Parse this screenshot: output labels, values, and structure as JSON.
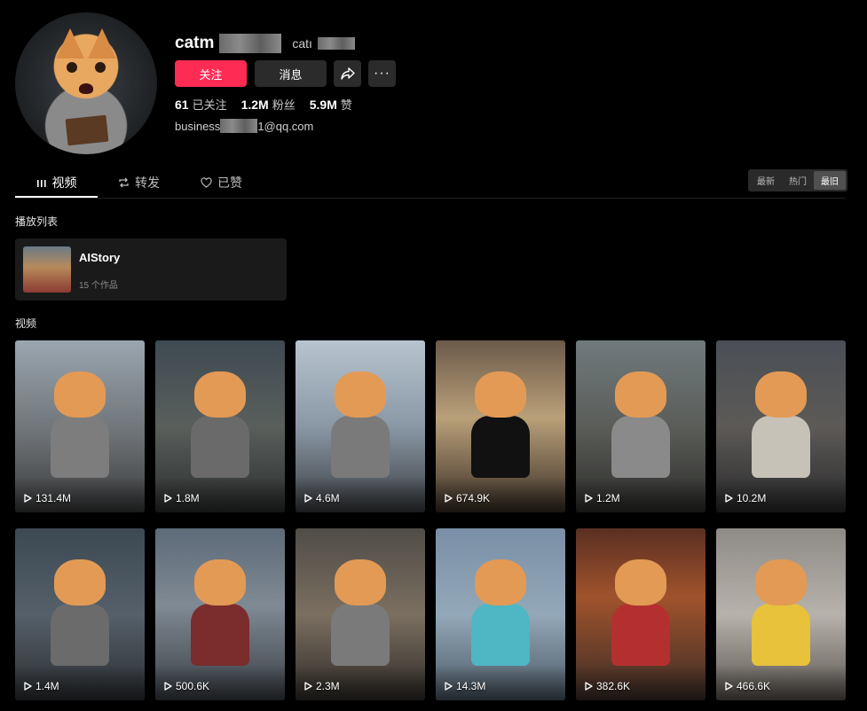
{
  "profile": {
    "username": "catm",
    "handle": "catı",
    "follow_label": "关注",
    "message_label": "消息",
    "more_label": "···",
    "stats": [
      {
        "value": "61",
        "label": "已关注"
      },
      {
        "value": "1.2M",
        "label": "粉丝"
      },
      {
        "value": "5.9M",
        "label": "赞"
      }
    ],
    "bio_prefix": "business",
    "bio_suffix": "1@qq.com"
  },
  "tabs": [
    {
      "label": "视频",
      "icon": "bars-icon",
      "active": true
    },
    {
      "label": "转发",
      "icon": "repost-icon",
      "active": false
    },
    {
      "label": "已赞",
      "icon": "heart-outline-icon",
      "active": false
    }
  ],
  "sort": [
    "最新",
    "热门",
    "最旧"
  ],
  "sort_active": "最旧",
  "playlist_section_title": "播放列表",
  "playlist": {
    "title": "AIStory",
    "count": "15 个作品"
  },
  "videos_section_title": "视频",
  "videos": [
    {
      "views": "131.4M"
    },
    {
      "views": "1.8M"
    },
    {
      "views": "4.6M"
    },
    {
      "views": "674.9K"
    },
    {
      "views": "1.2M"
    },
    {
      "views": "10.2M"
    },
    {
      "views": "1.4M"
    },
    {
      "views": "500.6K"
    },
    {
      "views": "2.3M"
    },
    {
      "views": "14.3M"
    },
    {
      "views": "382.6K"
    },
    {
      "views": "466.6K"
    }
  ],
  "colors": {
    "accent": "#fe2c55",
    "background": "#000000",
    "button": "#2b2b2b"
  }
}
